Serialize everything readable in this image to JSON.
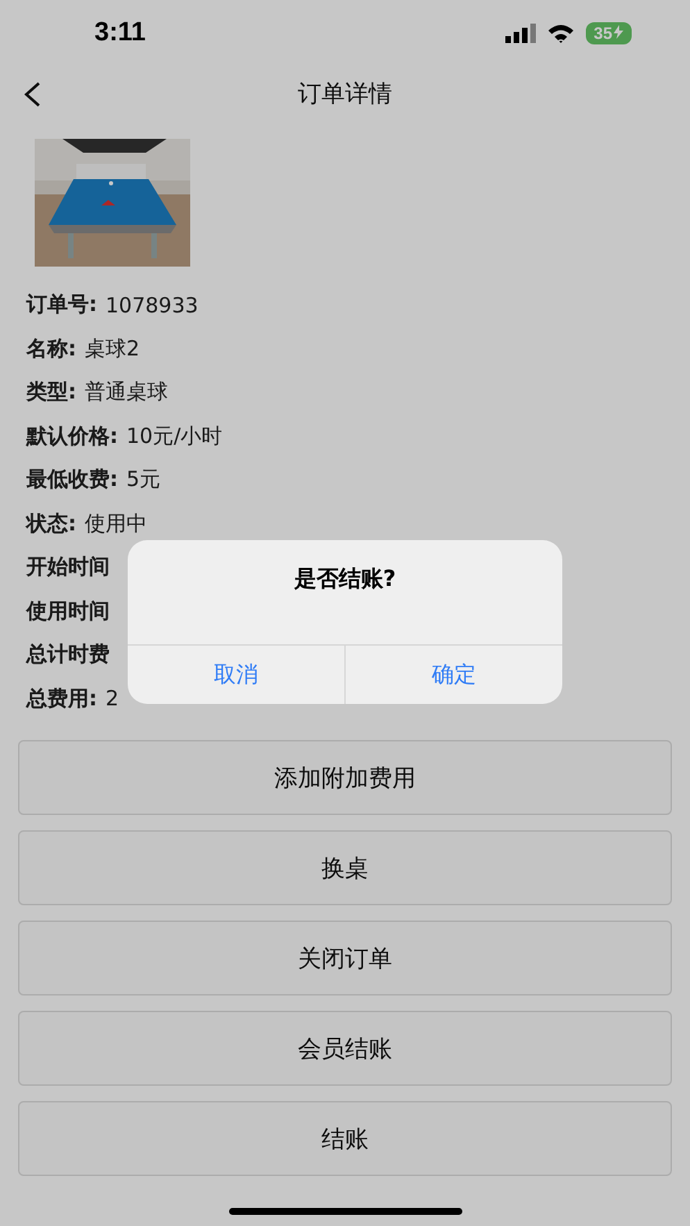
{
  "status_bar": {
    "time": "3:11",
    "battery": "35"
  },
  "nav": {
    "title": "订单详情"
  },
  "fields": [
    {
      "label": "订单号:",
      "value": "1078933"
    },
    {
      "label": "名称:",
      "value": "桌球2"
    },
    {
      "label": "类型:",
      "value": "普通桌球"
    },
    {
      "label": "默认价格:",
      "value": "10元/小时"
    },
    {
      "label": "最低收费:",
      "value": "5元"
    },
    {
      "label": "状态:",
      "value": "使用中"
    },
    {
      "label": "开始时间"
    },
    {
      "label": "使用时间"
    },
    {
      "label": "总计时费"
    },
    {
      "label": "总费用:",
      "value": "2"
    }
  ],
  "actions": [
    "添加附加费用",
    "换桌",
    "关闭订单",
    "会员结账",
    "结账"
  ],
  "dialog": {
    "title": "是否结账?",
    "buttons": [
      "取消",
      "确定"
    ]
  }
}
